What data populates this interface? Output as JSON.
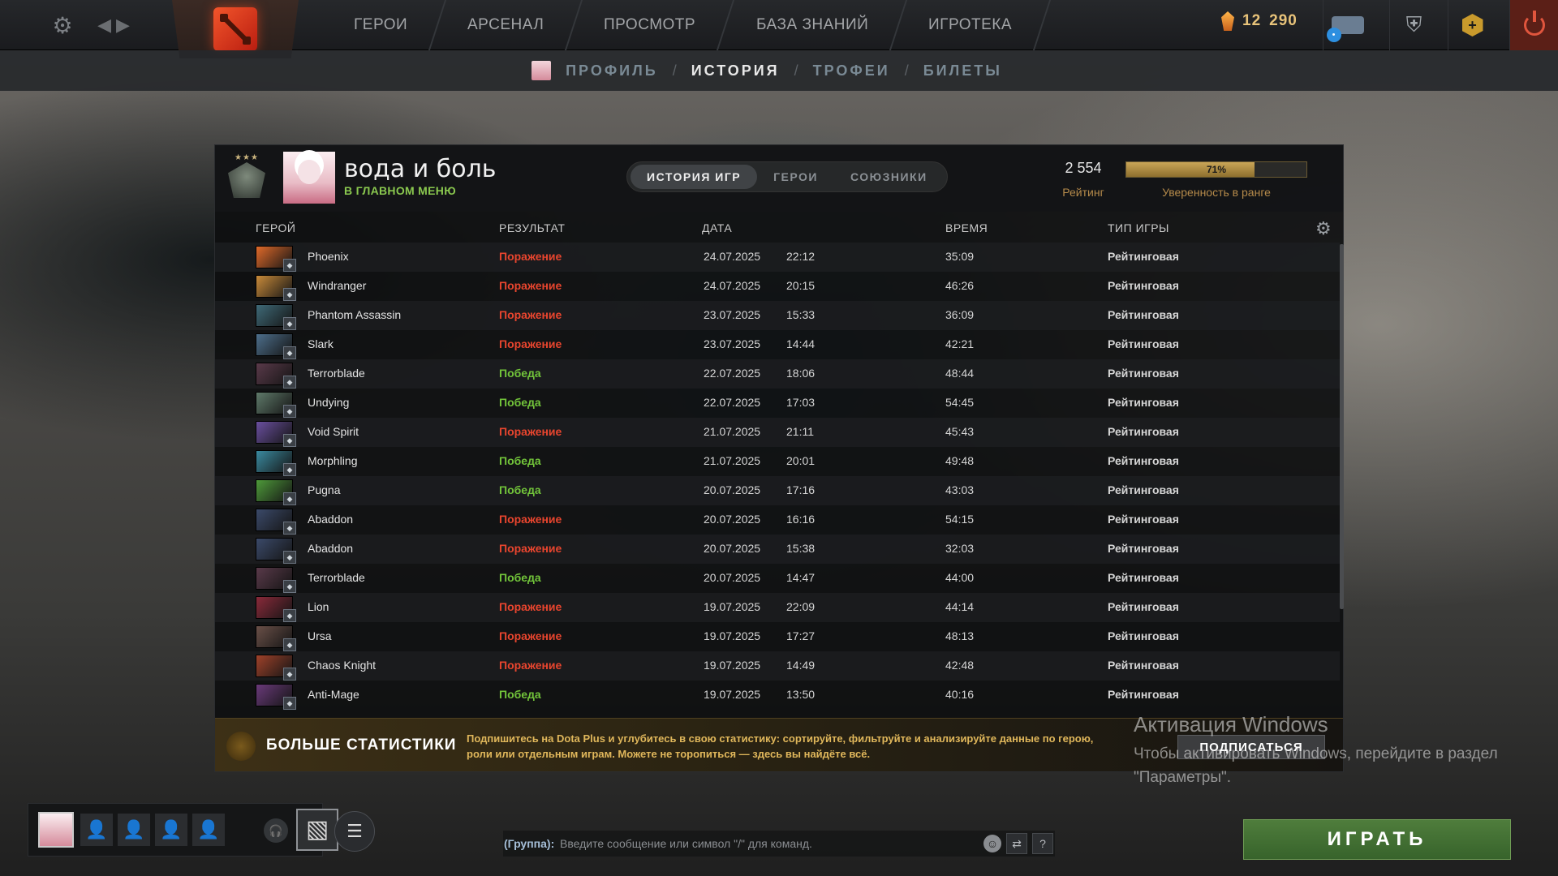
{
  "topbar": {
    "nav": [
      "ГЕРОИ",
      "АРСЕНАЛ",
      "ПРОСМОТР",
      "БАЗА ЗНАНИЙ",
      "ИГРОТЕКА"
    ],
    "currency_a": "12",
    "currency_b": "290",
    "icons": [
      "gear-icon",
      "back-arrow-icon",
      "dota-logo-icon",
      "chat-icon",
      "armory-icon",
      "dota-plus-icon",
      "power-icon"
    ]
  },
  "subnav": {
    "items": [
      "ПРОФИЛЬ",
      "ИСТОРИЯ",
      "ТРОФЕИ",
      "БИЛЕТЫ"
    ],
    "separator": "/",
    "active": "ИСТОРИЯ"
  },
  "profile": {
    "name": "вода и боль",
    "status": "В ГЛАВНОМ МЕНЮ",
    "tabs": [
      "ИСТОРИЯ ИГР",
      "ГЕРОИ",
      "СОЮЗНИКИ"
    ],
    "rating": "2 554",
    "rating_label": "Рейтинг",
    "confidence": "71%",
    "confidence_value": 0.71,
    "confidence_label": "Уверенность в ранге"
  },
  "columns": {
    "hero": "ГЕРОЙ",
    "result": "РЕЗУЛЬТАТ",
    "date": "ДАТА",
    "duration": "ВРЕМЯ",
    "mode": "ТИП ИГРЫ"
  },
  "matches": [
    {
      "hero": "Phoenix",
      "result": "Поражение",
      "date": "24.07.2025",
      "time": "22:12",
      "duration": "35:09",
      "mode": "Рейтинговая",
      "color": "#e06a2a"
    },
    {
      "hero": "Windranger",
      "result": "Поражение",
      "date": "24.07.2025",
      "time": "20:15",
      "duration": "46:26",
      "mode": "Рейтинговая",
      "color": "#c98b3a"
    },
    {
      "hero": "Phantom Assassin",
      "result": "Поражение",
      "date": "23.07.2025",
      "time": "15:33",
      "duration": "36:09",
      "mode": "Рейтинговая",
      "color": "#3f6a78"
    },
    {
      "hero": "Slark",
      "result": "Поражение",
      "date": "23.07.2025",
      "time": "14:44",
      "duration": "42:21",
      "mode": "Рейтинговая",
      "color": "#4d6f8c"
    },
    {
      "hero": "Terrorblade",
      "result": "Победа",
      "date": "22.07.2025",
      "time": "18:06",
      "duration": "48:44",
      "mode": "Рейтинговая",
      "color": "#5a3a4a"
    },
    {
      "hero": "Undying",
      "result": "Победа",
      "date": "22.07.2025",
      "time": "17:03",
      "duration": "54:45",
      "mode": "Рейтинговая",
      "color": "#5f7a6a"
    },
    {
      "hero": "Void Spirit",
      "result": "Поражение",
      "date": "21.07.2025",
      "time": "21:11",
      "duration": "45:43",
      "mode": "Рейтинговая",
      "color": "#6a4fa0"
    },
    {
      "hero": "Morphling",
      "result": "Победа",
      "date": "21.07.2025",
      "time": "20:01",
      "duration": "49:48",
      "mode": "Рейтинговая",
      "color": "#3a8aa0"
    },
    {
      "hero": "Pugna",
      "result": "Победа",
      "date": "20.07.2025",
      "time": "17:16",
      "duration": "43:03",
      "mode": "Рейтинговая",
      "color": "#4e9a3a"
    },
    {
      "hero": "Abaddon",
      "result": "Поражение",
      "date": "20.07.2025",
      "time": "16:16",
      "duration": "54:15",
      "mode": "Рейтинговая",
      "color": "#3b4a6a"
    },
    {
      "hero": "Abaddon",
      "result": "Поражение",
      "date": "20.07.2025",
      "time": "15:38",
      "duration": "32:03",
      "mode": "Рейтинговая",
      "color": "#3b4a6a"
    },
    {
      "hero": "Terrorblade",
      "result": "Победа",
      "date": "20.07.2025",
      "time": "14:47",
      "duration": "44:00",
      "mode": "Рейтинговая",
      "color": "#5a3a4a"
    },
    {
      "hero": "Lion",
      "result": "Поражение",
      "date": "19.07.2025",
      "time": "22:09",
      "duration": "44:14",
      "mode": "Рейтинговая",
      "color": "#8a2a3a"
    },
    {
      "hero": "Ursa",
      "result": "Поражение",
      "date": "19.07.2025",
      "time": "17:27",
      "duration": "48:13",
      "mode": "Рейтинговая",
      "color": "#6a5048"
    },
    {
      "hero": "Chaos Knight",
      "result": "Поражение",
      "date": "19.07.2025",
      "time": "14:49",
      "duration": "42:48",
      "mode": "Рейтинговая",
      "color": "#a0422a"
    },
    {
      "hero": "Anti-Mage",
      "result": "Победа",
      "date": "19.07.2025",
      "time": "13:50",
      "duration": "40:16",
      "mode": "Рейтинговая",
      "color": "#6a3a7a"
    }
  ],
  "stats_banner": {
    "title": "БОЛЬШЕ СТАТИСТИКИ",
    "description": "Подпишитесь на Dota Plus и углубитесь в свою статистику: сортируйте, фильтруйте и анализируйте данные по герою, роли или отдельным играм. Можете не торопиться — здесь вы найдёте всё.",
    "button": "ПОДПИСАТЬСЯ"
  },
  "windows_watermark": {
    "title": "Активация Windows",
    "text": "Чтобы активировать Windows, перейдите в раздел \"Параметры\"."
  },
  "chat": {
    "prefix": "(Группа):",
    "placeholder": "Введите сообщение или символ \"/\" для команд."
  },
  "play_button": "ИГРАТЬ",
  "result_colors": {
    "win": "#72c43a",
    "loss": "#e8452e"
  }
}
